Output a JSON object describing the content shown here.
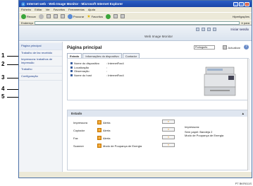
{
  "window": {
    "title": "Internet web - Web Image Monitor - Microsoft Internet Explorer",
    "menu": [
      "Ficheiro",
      "Editar",
      "Ver",
      "Favoritos",
      "Ferramentas",
      "Ajuda"
    ],
    "toolbar": {
      "back_label": "Recuar",
      "search_label": "Procurar",
      "favorites_label": "Favoritos",
      "links_label": "Hiperligações"
    },
    "address_label": "Endereço",
    "go_label": "Ir para"
  },
  "wim": {
    "title": "Web Image Monitor",
    "login_label": "Iniciar sessão"
  },
  "sidebar": {
    "items": [
      {
        "label": "Página principal"
      },
      {
        "label": "Trabalho de fax recebido"
      },
      {
        "label": "Impressora: trabalhos de impressão"
      },
      {
        "label": "Trabalho"
      },
      {
        "label": "Configuração"
      }
    ]
  },
  "callouts": [
    "1",
    "2",
    "3",
    "4",
    "5"
  ],
  "main": {
    "page_title": "Página principal",
    "language": "Português",
    "refresh_label": "Actualizar",
    "help_label": "?",
    "tabs": [
      "Estado",
      "Informações do dispositivo",
      "Contador"
    ],
    "info": [
      {
        "key": "Nome do dispositivo",
        "value": ": InternetFax4"
      },
      {
        "key": "Localização",
        "value": ":"
      },
      {
        "key": "Observação",
        "value": ":"
      },
      {
        "key": "Nome do host",
        "value": ": InternetFax4"
      }
    ],
    "status_title": "Estado",
    "status_rows": [
      {
        "device": "Impressora",
        "state": "Alerta",
        "message": "Impressora:"
      },
      {
        "device": "Copiador",
        "state": "Alerta",
        "message": "Sem papel: Bandeja 2"
      },
      {
        "device": "Fax",
        "state": "Alerta",
        "message": "Modo de Poupança de Energia"
      },
      {
        "device": "Scanner",
        "state": "Modo de Poupança de Energia",
        "message": ""
      }
    ]
  },
  "caption": "PT BKR011S",
  "colors": {
    "accent": "#2a5cc5",
    "warning": "#f0a12a",
    "link": "#1d3f8a"
  }
}
